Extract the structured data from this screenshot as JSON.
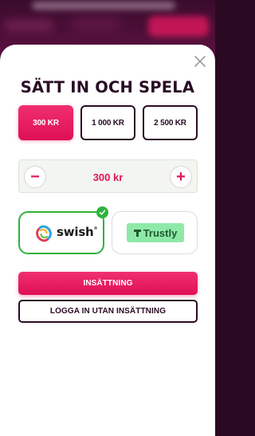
{
  "modal": {
    "title": "SÄTT IN OCH SPELA"
  },
  "amounts": [
    {
      "label": "300 KR",
      "selected": true
    },
    {
      "label": "1 000 KR",
      "selected": false
    },
    {
      "label": "2 500 KR",
      "selected": false
    }
  ],
  "stepper": {
    "minus_symbol": "−",
    "value": "300 kr",
    "plus_symbol": "+"
  },
  "payment_methods": {
    "swish": {
      "label": "swish",
      "trademark": "®",
      "selected": true
    },
    "trustly": {
      "label": "Trustly",
      "selected": false
    }
  },
  "actions": {
    "deposit_label": "INSÄTTNING",
    "login_without_deposit_label": "LOGGA IN UTAN INSÄTTNING"
  },
  "colors": {
    "accent": "#e0145c",
    "dark": "#2a0b25",
    "success": "#2fb33c",
    "trustly_green": "#8ee9a8"
  },
  "icons": {
    "close": "close-icon",
    "selected_check": "check-icon",
    "swish": "swish-logo-icon",
    "trustly": "trustly-logo-icon"
  }
}
